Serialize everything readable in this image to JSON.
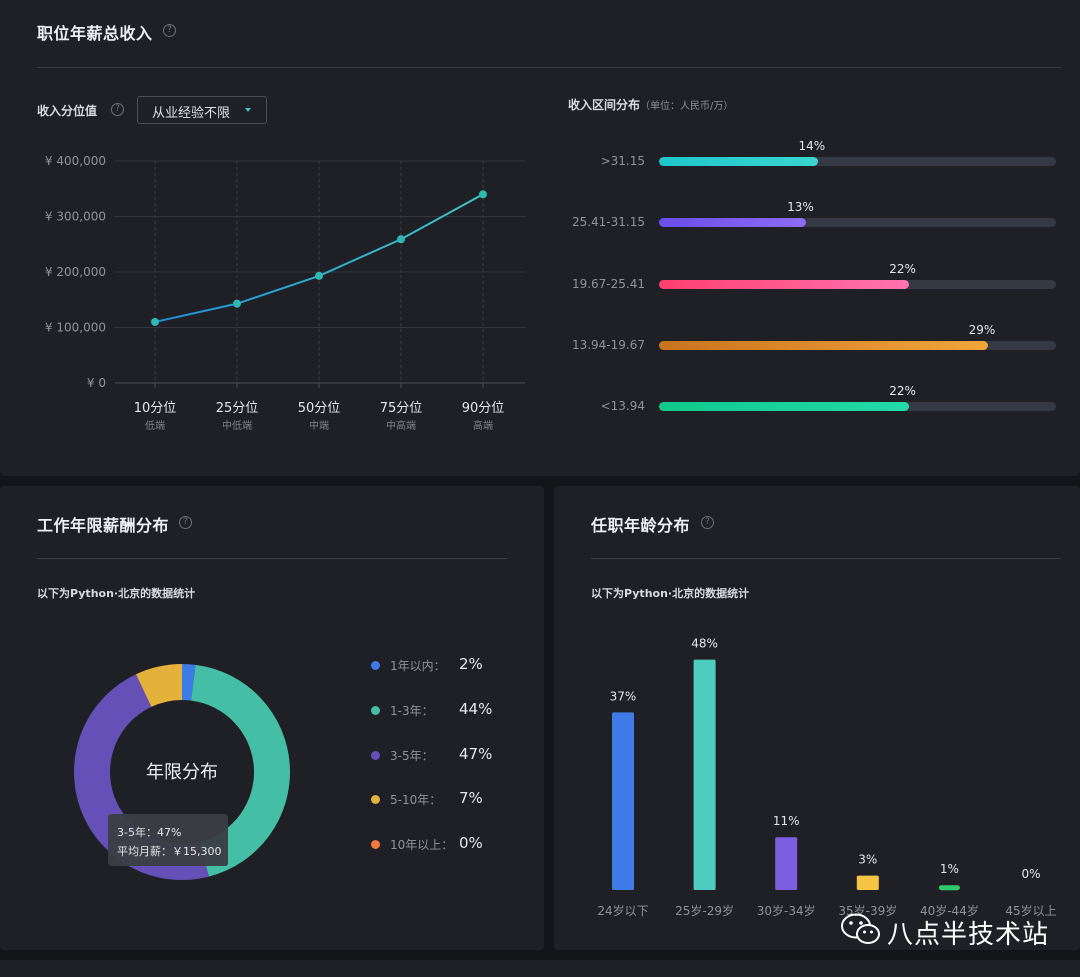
{
  "salary_panel": {
    "title": "职位年薪总收入",
    "percentile_label": "收入分位值",
    "experience_filter": "从业经验不限",
    "range_title": "收入区间分布",
    "range_unit": "（单位：人民币/万）"
  },
  "experience_panel": {
    "title": "工作年限薪酬分布",
    "note": "以下为Python·北京的数据统计",
    "donut_center": "年限分布",
    "tooltip": {
      "line1": "3-5年：47%",
      "line2": "平均月薪：￥15,300"
    }
  },
  "age_panel": {
    "title": "任职年龄分布",
    "note": "以下为Python·北京的数据统计"
  },
  "watermark": {
    "text": "八点半技术站",
    "icon": "wechat-icon"
  },
  "colors": {
    "line": "#2fb7b2",
    "ranges": [
      "#1ec7cc",
      "#7b5cf0",
      "#ff4f86",
      "#f29b2c",
      "#18d29a"
    ],
    "experience": [
      "#3f7be6",
      "#45bea6",
      "#6550b8",
      "#e4b23a",
      "#f07a3f"
    ],
    "ages": [
      "#3f7be6",
      "#4ecdbf",
      "#7b5fe0",
      "#f6c546",
      "#2fc96b",
      "#8f939c"
    ]
  },
  "chart_data": [
    {
      "type": "line",
      "categories": [
        "10分位",
        "25分位",
        "50分位",
        "75分位",
        "90分位"
      ],
      "sub_labels": [
        "低端",
        "中低端",
        "中端",
        "中高端",
        "高端"
      ],
      "values": [
        110000,
        143000,
        193000,
        259000,
        340000
      ],
      "yticks": [
        "¥ 0",
        "¥ 100,000",
        "¥ 200,000",
        "¥ 300,000",
        "¥ 400,000"
      ],
      "ylim": [
        0,
        400000
      ],
      "grid": true
    },
    {
      "type": "bar",
      "orientation": "horizontal",
      "categories": [
        ">31.15",
        "25.41-31.15",
        "19.67-25.41",
        "13.94-19.67",
        "<13.94"
      ],
      "values": [
        14,
        13,
        22,
        29,
        22
      ],
      "labels": [
        "14%",
        "13%",
        "22%",
        "29%",
        "22%"
      ],
      "xlim": [
        0,
        35
      ]
    },
    {
      "type": "pie",
      "categories": [
        "1年以内：",
        "1-3年：",
        "3-5年：",
        "5-10年：",
        "10年以上："
      ],
      "values": [
        2,
        44,
        47,
        7,
        0
      ],
      "labels": [
        "2%",
        "44%",
        "47%",
        "7%",
        "0%"
      ]
    },
    {
      "type": "bar",
      "categories": [
        "24岁以下",
        "25岁-29岁",
        "30岁-34岁",
        "35岁-39岁",
        "40岁-44岁",
        "45岁以上"
      ],
      "values": [
        37,
        48,
        11,
        3,
        1,
        0
      ],
      "labels": [
        "37%",
        "48%",
        "11%",
        "3%",
        "1%",
        "0%"
      ],
      "ylim": [
        0,
        50
      ]
    }
  ]
}
